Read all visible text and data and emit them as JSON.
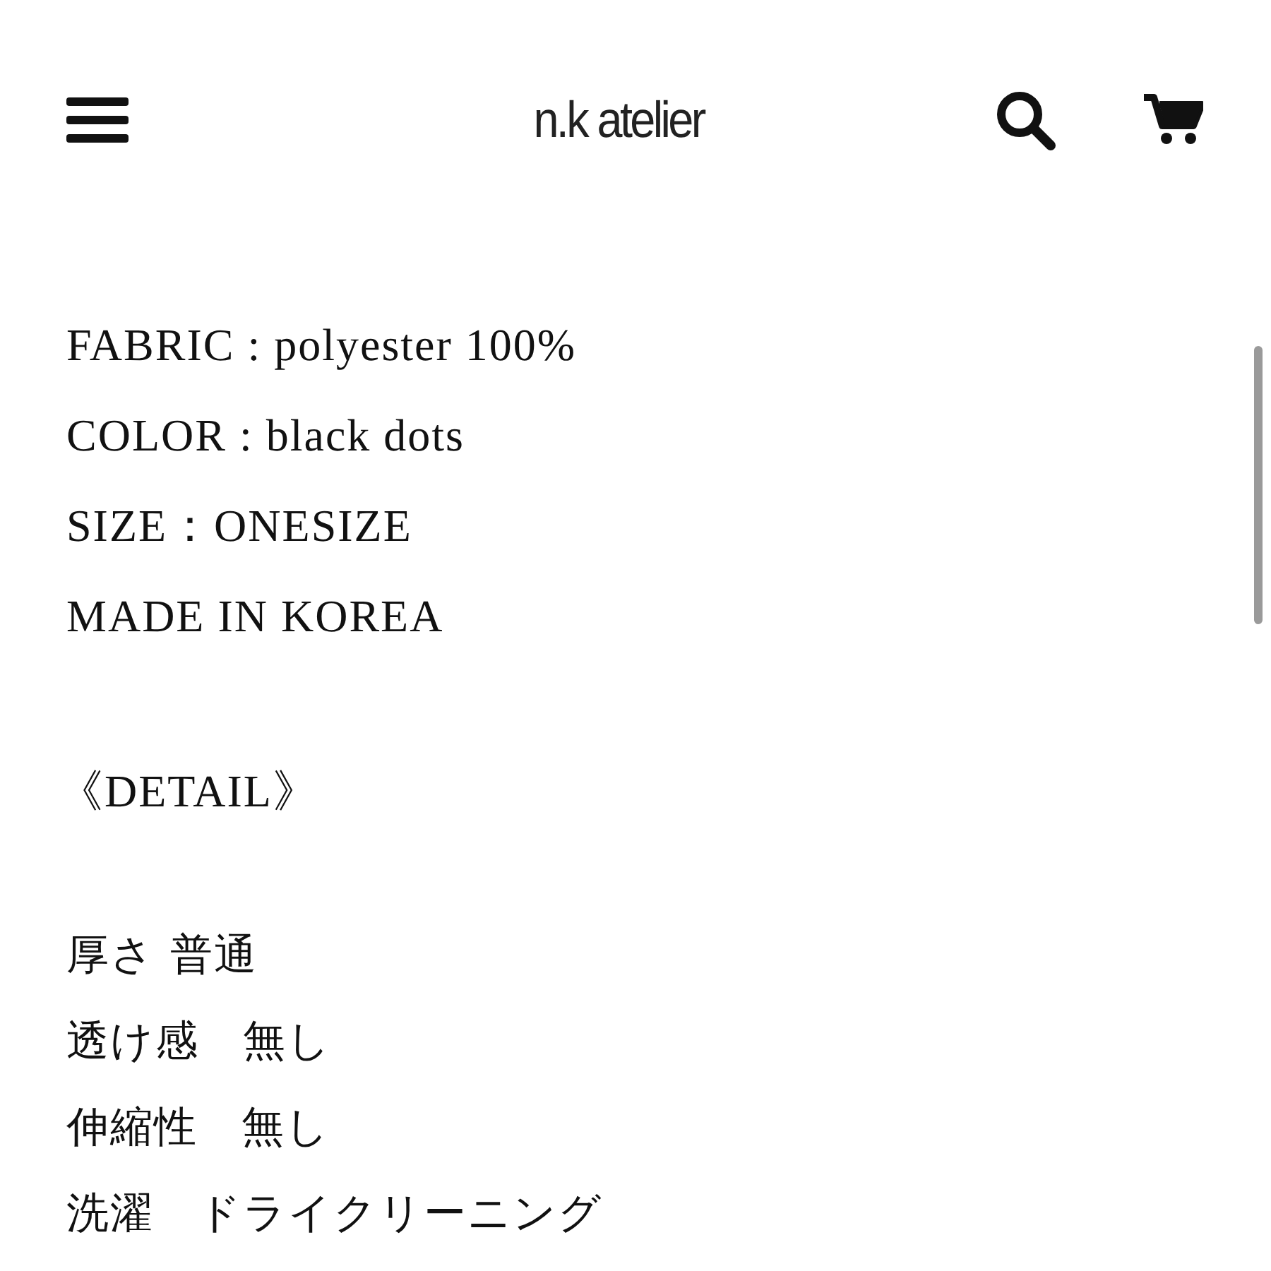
{
  "header": {
    "logo": "n.k atelier"
  },
  "specs": [
    "FABRIC : polyester 100%",
    "COLOR : black dots",
    "SIZE：ONESIZE",
    "MADE IN KOREA"
  ],
  "detail_heading": "《DETAIL》",
  "details": [
    "厚さ 普通",
    "透け感　無し",
    "伸縮性　無し",
    "洗濯　ドライクリーニング"
  ]
}
